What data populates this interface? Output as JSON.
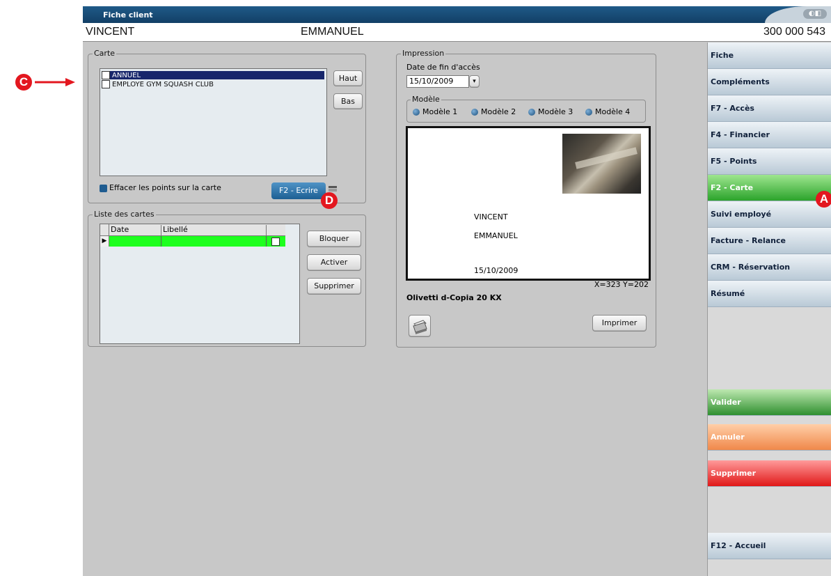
{
  "window": {
    "title": "Fiche client",
    "controls": "◐◧"
  },
  "client": {
    "last_name": "VINCENT",
    "first_name": "EMMANUEL",
    "number": "300 000 543"
  },
  "carte": {
    "legend": "Carte",
    "items": [
      {
        "label": "ANNUEL",
        "checked": true,
        "selected": true
      },
      {
        "label": "EMPLOYE GYM SQUASH CLUB",
        "checked": false,
        "selected": false
      }
    ],
    "up_label": "Haut",
    "down_label": "Bas",
    "erase_label": "Effacer les points sur la carte",
    "write_label": "F2 - Ecrire"
  },
  "liste": {
    "legend": "Liste des cartes",
    "columns": [
      "Date",
      "Libellé",
      ""
    ],
    "rows": [
      {
        "date": "",
        "libelle": "",
        "checked": false
      }
    ],
    "block_label": "Bloquer",
    "activate_label": "Activer",
    "delete_label": "Supprimer"
  },
  "impression": {
    "legend": "Impression",
    "date_label": "Date de fin d'accès",
    "date_value": "15/10/2009",
    "model_legend": "Modèle",
    "models": [
      "Modèle 1",
      "Modèle 2",
      "Modèle 3",
      "Modèle 4"
    ],
    "selected_model": "Modèle 1",
    "preview": {
      "last_name": "VINCENT",
      "first_name": "EMMANUEL",
      "date": "15/10/2009"
    },
    "coords": "X=323 Y=202",
    "printer": "Olivetti d-Copia 20 KX",
    "print_label": "Imprimer"
  },
  "sidebar": {
    "items": [
      {
        "label": "Fiche",
        "style": "normal"
      },
      {
        "label": "Compléments",
        "style": "normal"
      },
      {
        "label": "F7 - Accès",
        "style": "normal"
      },
      {
        "label": "F4 - Financier",
        "style": "normal"
      },
      {
        "label": "F5 - Points",
        "style": "normal"
      },
      {
        "label": "F2 - Carte",
        "style": "active"
      },
      {
        "label": "Suivi employé",
        "style": "normal"
      },
      {
        "label": "Facture - Relance",
        "style": "normal"
      },
      {
        "label": "CRM - Réservation",
        "style": "normal"
      },
      {
        "label": "Résumé",
        "style": "normal"
      }
    ],
    "validate_label": "Valider",
    "cancel_label": "Annuler",
    "delete_label": "Supprimer",
    "home_label": "F12 - Accueil"
  },
  "annotations": {
    "a": "A",
    "c": "C",
    "d": "D"
  },
  "colors": {
    "title_bar": "#1a4c76",
    "active_green": "#2ba32b",
    "selected_row": "#17266b",
    "row_green": "#1eff1e",
    "annotation_red": "#e3171f"
  }
}
